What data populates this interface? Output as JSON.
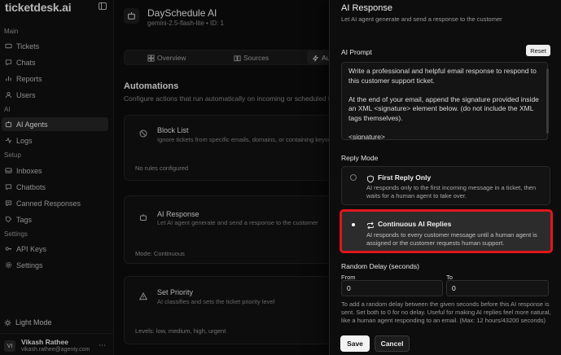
{
  "sidebar": {
    "brand": "ticketdesk.ai",
    "sections": {
      "main": "Main",
      "ai": "AI",
      "setup": "Setup",
      "settings": "Settings"
    },
    "items": {
      "tickets": "Tickets",
      "chats": "Chats",
      "reports": "Reports",
      "users": "Users",
      "ai_agents": "AI Agents",
      "logs": "Logs",
      "inboxes": "Inboxes",
      "chatbots": "Chatbots",
      "canned_responses": "Canned Responses",
      "tags": "Tags",
      "api_keys": "API Keys",
      "settings": "Settings"
    },
    "light_mode": "Light Mode",
    "user": {
      "initials": "VI",
      "name": "Vikash Rathee",
      "email": "vikash.rathee@agenty.com"
    }
  },
  "agent": {
    "title": "DaySchedule AI",
    "subtitle": "gemini-2.5-flash-lite • ID: 1",
    "tabs": {
      "overview": "Overview",
      "sources": "Sources",
      "automations": "Au"
    }
  },
  "automations": {
    "heading": "Automations",
    "description": "Configure actions that run automatically on incoming or scheduled ti",
    "cards": [
      {
        "title": "Block List",
        "desc": "Ignore tickets from specific emails, domains, or containing keywor",
        "foot": "No rules configured"
      },
      {
        "title": "AI Response",
        "desc": "Let AI agent generate and send a response to the customer",
        "foot": "Mode: Continuous"
      },
      {
        "title": "Set Priority",
        "desc": "AI classifies and sets the ticket priority level",
        "foot": "Levels: low, medium, high, urgent"
      }
    ]
  },
  "drawer": {
    "title": "AI Response",
    "subtitle": "Let AI agent generate and send a response to the customer",
    "prompt_label": "AI Prompt",
    "reset_label": "Reset",
    "prompt_text": "Write a professional and helpful email response to respond to this customer support ticket.\n\nAt the end of your email, append the signature provided inside an XML <signature> element below. (do not include the XML tags themselves).\n\n<signature>\nIf my answer was not good enough, simply reply \"I prefer",
    "reply_mode_label": "Reply Mode",
    "options": [
      {
        "title": "First Reply Only",
        "desc": "AI responds only to the first incoming message in a ticket, then waits for a human agent to take over."
      },
      {
        "title": "Continuous AI Replies",
        "desc": "AI responds to every customer message until a human agent is assigned or the customer requests human support."
      }
    ],
    "delay_label": "Random Delay (seconds)",
    "from_label": "From",
    "to_label": "To",
    "from_value": "0",
    "to_value": "0",
    "help_text": "To add a random delay between the given seconds before this AI response is sent. Set both to 0 for no delay. Useful for making AI replies feel more natural, like a human agent responding to an email. (Max: 12 hours/43200 seconds)",
    "save_label": "Save",
    "cancel_label": "Cancel"
  },
  "colors": {
    "background": "#0c0c0c",
    "highlight": "#e0161b",
    "active_nav": "#262626"
  }
}
